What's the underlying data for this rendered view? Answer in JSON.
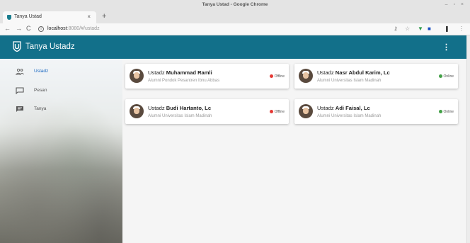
{
  "browser": {
    "window_title": "Tanya Ustad - Google Chrome",
    "tab_title": "Tanya Ustad",
    "url_host": "localhost",
    "url_rest": ":8080/#/ustadz"
  },
  "app": {
    "title": "Tanya Ustadz",
    "accent_color": "#12708a"
  },
  "sidebar": {
    "items": [
      {
        "label": "Ustadz",
        "icon": "people-icon",
        "active": true
      },
      {
        "label": "Pesan",
        "icon": "chat-bubble-outline-icon",
        "active": false
      },
      {
        "label": "Tanya",
        "icon": "chat-bubble-filled-icon",
        "active": false
      }
    ]
  },
  "ustadz_list": [
    {
      "prefix": "Ustadz",
      "name": "Muhammad Ramli",
      "affiliation": "Alumni Pondok Pesantren Ibnu Abbas",
      "status": "Offline",
      "status_color": "#e53935"
    },
    {
      "prefix": "Ustadz",
      "name": "Nasr Abdul Karim, Lc",
      "affiliation": "Alumni Universitas Islam Madinah",
      "status": "Online",
      "status_color": "#43a047"
    },
    {
      "prefix": "Ustadz",
      "name": "Budi Hartanto, Lc",
      "affiliation": "Alumni Universitas Islam Madinah",
      "status": "Offline",
      "status_color": "#e53935"
    },
    {
      "prefix": "Ustadz",
      "name": "Adi Faisal, Lc",
      "affiliation": "Alumni Universitas Islam Madinah",
      "status": "Online",
      "status_color": "#43a047"
    }
  ]
}
